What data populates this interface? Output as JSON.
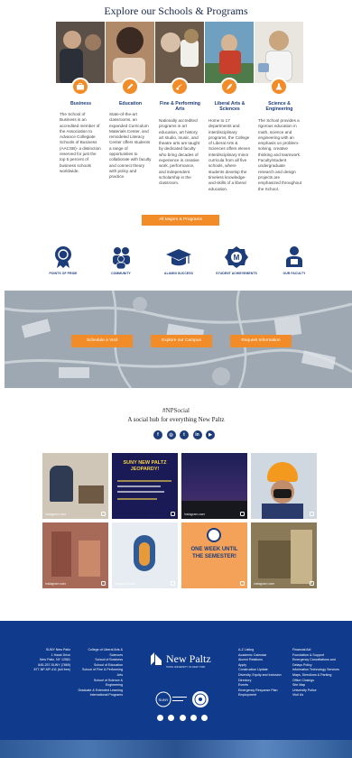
{
  "section_title": "Explore our Schools & Programs",
  "schools": [
    {
      "name": "Business",
      "desc": "The School of Business is an accredited member of the Association to Advance Collegiate Schools of Business (AACSB)- a distinction reserved for just the top 5 percent of business schools worldwide."
    },
    {
      "name": "Education",
      "desc": "State-of-the-art classrooms, an expanded Curriculum Materials Center, and remodeled Literacy Center offers students a range of opportunities to collaborate with faculty and connect theory with policy and practice."
    },
    {
      "name": "Fine & Performing Arts",
      "desc": "Nationally accredited programs in art education, art history, art studio, music, and theatre arts are taught by dedicated faculty who bring decades of experience in creative work, performance, and independent scholarship in the classroom."
    },
    {
      "name": "Liberal Arts & Sciences",
      "desc": "Home to 17 departments and interdisciplinary programs, the College of Liberal Arts & Sciences offers eleven interdisciplinary minor curricula from all five schools, where students develop the timeless knowledge-and-skills of a liberal education."
    },
    {
      "name": "Science & Engineering",
      "desc": "The School provides a rigorous education in math, science and engineering with an emphasis on problem-solving, creative thinking and teamwork. Faculty/student undergraduate research and design projects are emphasized throughout the School."
    }
  ],
  "all_majors_label": "All Majors & Programs",
  "pride": [
    {
      "label": "POINTS OF PRIDE",
      "icon": "ribbon-icon"
    },
    {
      "label": "COMMUNITY",
      "icon": "community-icon"
    },
    {
      "label": "ALUMNI SUCCESS",
      "icon": "graduation-cap-icon"
    },
    {
      "label": "STUDENT ACHIEVEMENTS",
      "icon": "achievement-badge-icon"
    },
    {
      "label": "OUR FACULTY",
      "icon": "faculty-icon"
    }
  ],
  "map_buttons": [
    "Schedule a Visit",
    "Explore our Campus",
    "Request Information"
  ],
  "social": {
    "handle": "#NPSocial",
    "subtitle": "A social hub for everything New Paltz",
    "icons": [
      "facebook-icon",
      "instagram-icon",
      "twitter-icon",
      "linkedin-icon",
      "youtube-icon"
    ]
  },
  "tiles": [
    {
      "caption": "instagram user",
      "text": ""
    },
    {
      "caption": "",
      "text": "SUNY NEW PALTZ JEOPARDY!"
    },
    {
      "caption": "instagram user",
      "text": ""
    },
    {
      "caption": "",
      "text": ""
    },
    {
      "caption": "instagram user",
      "text": ""
    },
    {
      "caption": "instagram user",
      "text": ""
    },
    {
      "caption": "instagram user",
      "text": "ONE WEEK UNTIL THE SEMESTER!"
    },
    {
      "caption": "instagram user",
      "text": ""
    }
  ],
  "footer": {
    "address": [
      "SUNY New Paltz",
      "1 Hawk Drive",
      "New Paltz, NY 12561",
      "845-257-SUNY (7869)",
      "877-NP-NP-411 (toll free)"
    ],
    "schools_links": [
      "College of Liberal Arts & Sciences",
      "School of Business",
      "School of Education",
      "School of Fine & Performing Arts",
      "School of Science & Engineering",
      "Graduate & Extended Learning",
      "International Programs"
    ],
    "logo_title": "New Paltz",
    "logo_sub": "STATE UNIVERSITY OF NEW YORK",
    "links_a": [
      "A-Z Listing",
      "Academic Calendar",
      "Alumni Relations",
      "Apply",
      "Construction Update",
      "Diversity, Equity and Inclusion",
      "Directory",
      "Events",
      "Emergency Response Plan",
      "Employment"
    ],
    "links_b": [
      "Financial Aid",
      "Foundation & Support",
      "Emergency Cancellations and Delays Policy",
      "Information Technology Services",
      "Maps, Directions & Parking",
      "Office Closings",
      "Site Map",
      "University Police",
      "Visit Us"
    ]
  },
  "colors": {
    "orange": "#f28c28",
    "navy": "#1d3c7a",
    "footer": "#103a8c"
  }
}
